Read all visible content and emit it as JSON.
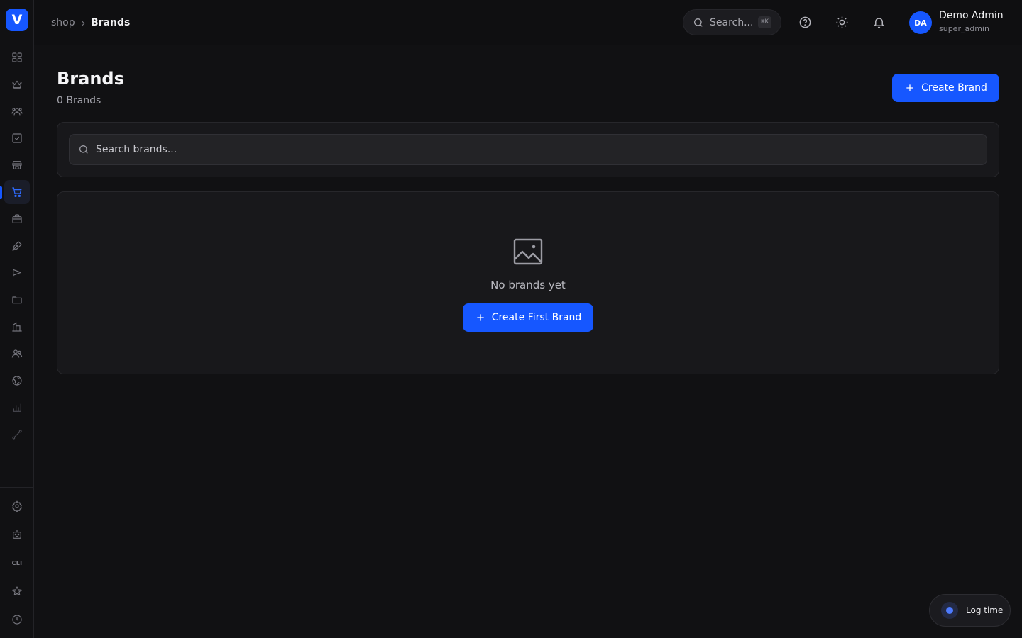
{
  "colors": {
    "accent": "#1657ff",
    "background": "#111113",
    "card": "#18181b"
  },
  "sidebar": {
    "logo_letter": "V",
    "items": [
      {
        "icon": "dashboard-grid-icon"
      },
      {
        "icon": "crown-icon"
      },
      {
        "icon": "users-group-icon"
      },
      {
        "icon": "checkbox-icon"
      },
      {
        "icon": "store-icon"
      },
      {
        "icon": "shopping-cart-icon",
        "active": true
      },
      {
        "icon": "briefcase-icon"
      },
      {
        "icon": "pen-icon"
      },
      {
        "icon": "megaphone-icon"
      },
      {
        "icon": "folder-icon"
      },
      {
        "icon": "building-icon"
      },
      {
        "icon": "users-icon"
      },
      {
        "icon": "globe-icon"
      },
      {
        "icon": "bar-chart-icon"
      },
      {
        "icon": "route-icon"
      }
    ],
    "bottom_items": [
      {
        "icon": "gear-icon"
      },
      {
        "icon": "robot-icon"
      },
      {
        "icon": "cli-icon",
        "label": "CLI"
      },
      {
        "icon": "star-icon"
      },
      {
        "icon": "clock-icon"
      }
    ]
  },
  "header": {
    "breadcrumb": [
      "shop",
      "Brands"
    ],
    "search_label": "Search...",
    "search_shortcut": "⌘K",
    "icons": [
      "help-icon",
      "sun-icon",
      "bell-icon"
    ],
    "user": {
      "initials": "DA",
      "name": "Demo Admin",
      "role": "super_admin"
    }
  },
  "page": {
    "title": "Brands",
    "subtitle": "0 Brands",
    "create_button": "Create Brand",
    "search_placeholder": "Search brands...",
    "empty_text": "No brands yet",
    "empty_button": "Create First Brand"
  },
  "floating": {
    "log_time": "Log time"
  }
}
